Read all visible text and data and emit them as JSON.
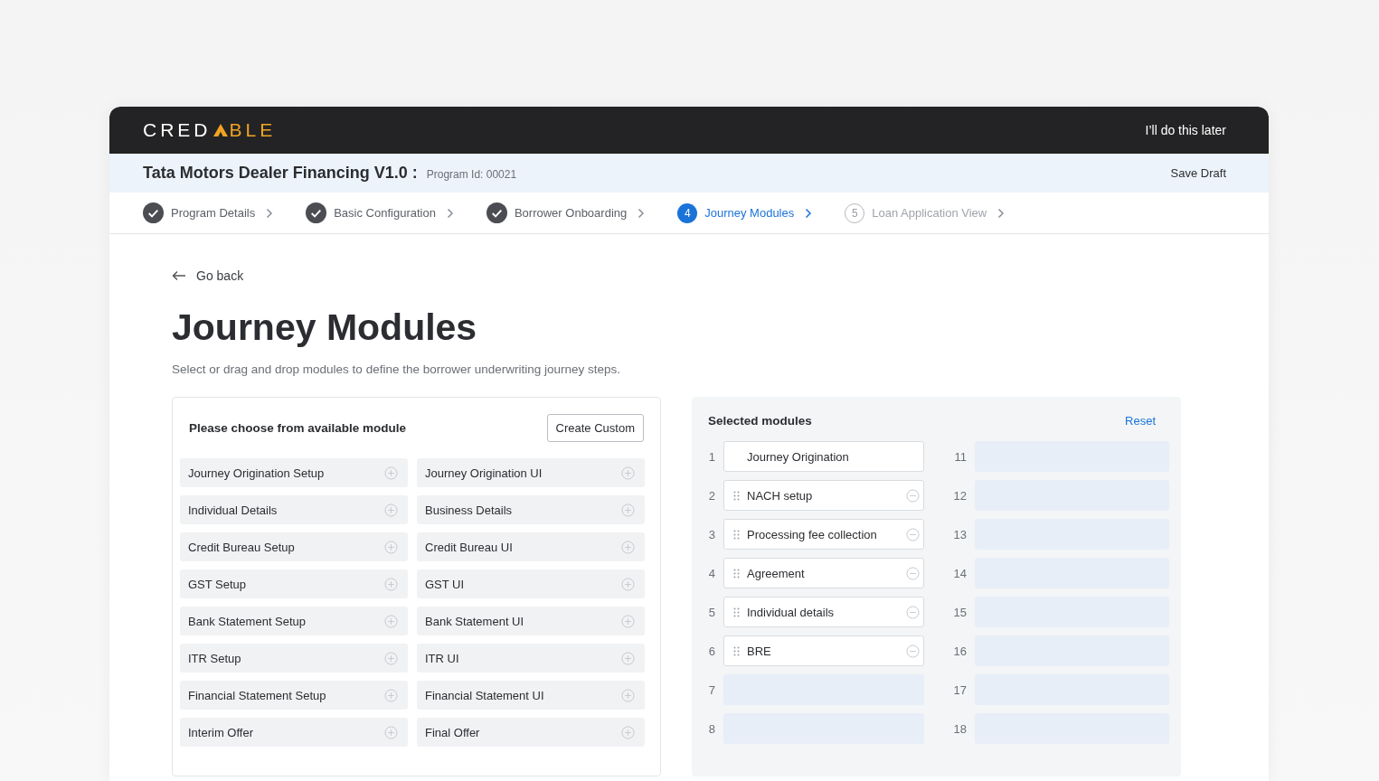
{
  "brand": {
    "left": "CRED",
    "right": "BLE"
  },
  "header": {
    "skip_link": "I’ll do this later"
  },
  "program": {
    "title": "Tata Motors Dealer Financing V1.0 :",
    "program_id": "Program Id: 00021",
    "save": "Save Draft"
  },
  "steps": [
    {
      "label": "Program Details",
      "completed": true,
      "selected": false
    },
    {
      "label": "Basic Configuration",
      "completed": true,
      "selected": false
    },
    {
      "label": "Borrower Onboarding",
      "completed": true,
      "selected": false
    },
    {
      "label": "Journey Modules",
      "completed": false,
      "selected": true,
      "number": "4"
    },
    {
      "label": "Loan Application View",
      "completed": false,
      "selected": false,
      "number": "5"
    }
  ],
  "back": "Go back",
  "title": "Journey Modules",
  "subtitle": "Select or drag and drop modules to define the borrower underwriting journey steps.",
  "available": {
    "heading": "Please choose from available module",
    "create_button": "Create Custom",
    "modules": [
      "Journey Origination Setup",
      "Journey Origination UI",
      "Individual Details",
      "Business Details",
      "Credit Bureau Setup",
      "Credit Bureau UI",
      "GST Setup",
      "GST UI",
      "Bank Statement Setup",
      "Bank Statement UI",
      "ITR Setup",
      "ITR UI",
      "Financial Statement Setup",
      "Financial Statement UI",
      "Interim Offer",
      "Final Offer"
    ]
  },
  "selected": {
    "heading": "Selected modules",
    "reset": "Reset",
    "columns": [
      {
        "slots": [
          {
            "number": "1",
            "label": "Journey Origination",
            "draggable": false,
            "removable": false
          },
          {
            "number": "2",
            "label": "NACH setup",
            "draggable": true,
            "removable": true
          },
          {
            "number": "3",
            "label": "Processing fee collection",
            "draggable": true,
            "removable": true
          },
          {
            "number": "4",
            "label": "Agreement",
            "draggable": true,
            "removable": true
          },
          {
            "number": "5",
            "label": "Individual details",
            "draggable": true,
            "removable": true
          },
          {
            "number": "6",
            "label": "BRE",
            "draggable": true,
            "removable": true
          },
          {
            "number": "7"
          },
          {
            "number": "8"
          }
        ]
      },
      {
        "slots": [
          {
            "number": "11"
          },
          {
            "number": "12"
          },
          {
            "number": "13"
          },
          {
            "number": "14"
          },
          {
            "number": "15"
          },
          {
            "number": "16"
          },
          {
            "number": "17"
          },
          {
            "number": "18"
          }
        ]
      }
    ]
  }
}
